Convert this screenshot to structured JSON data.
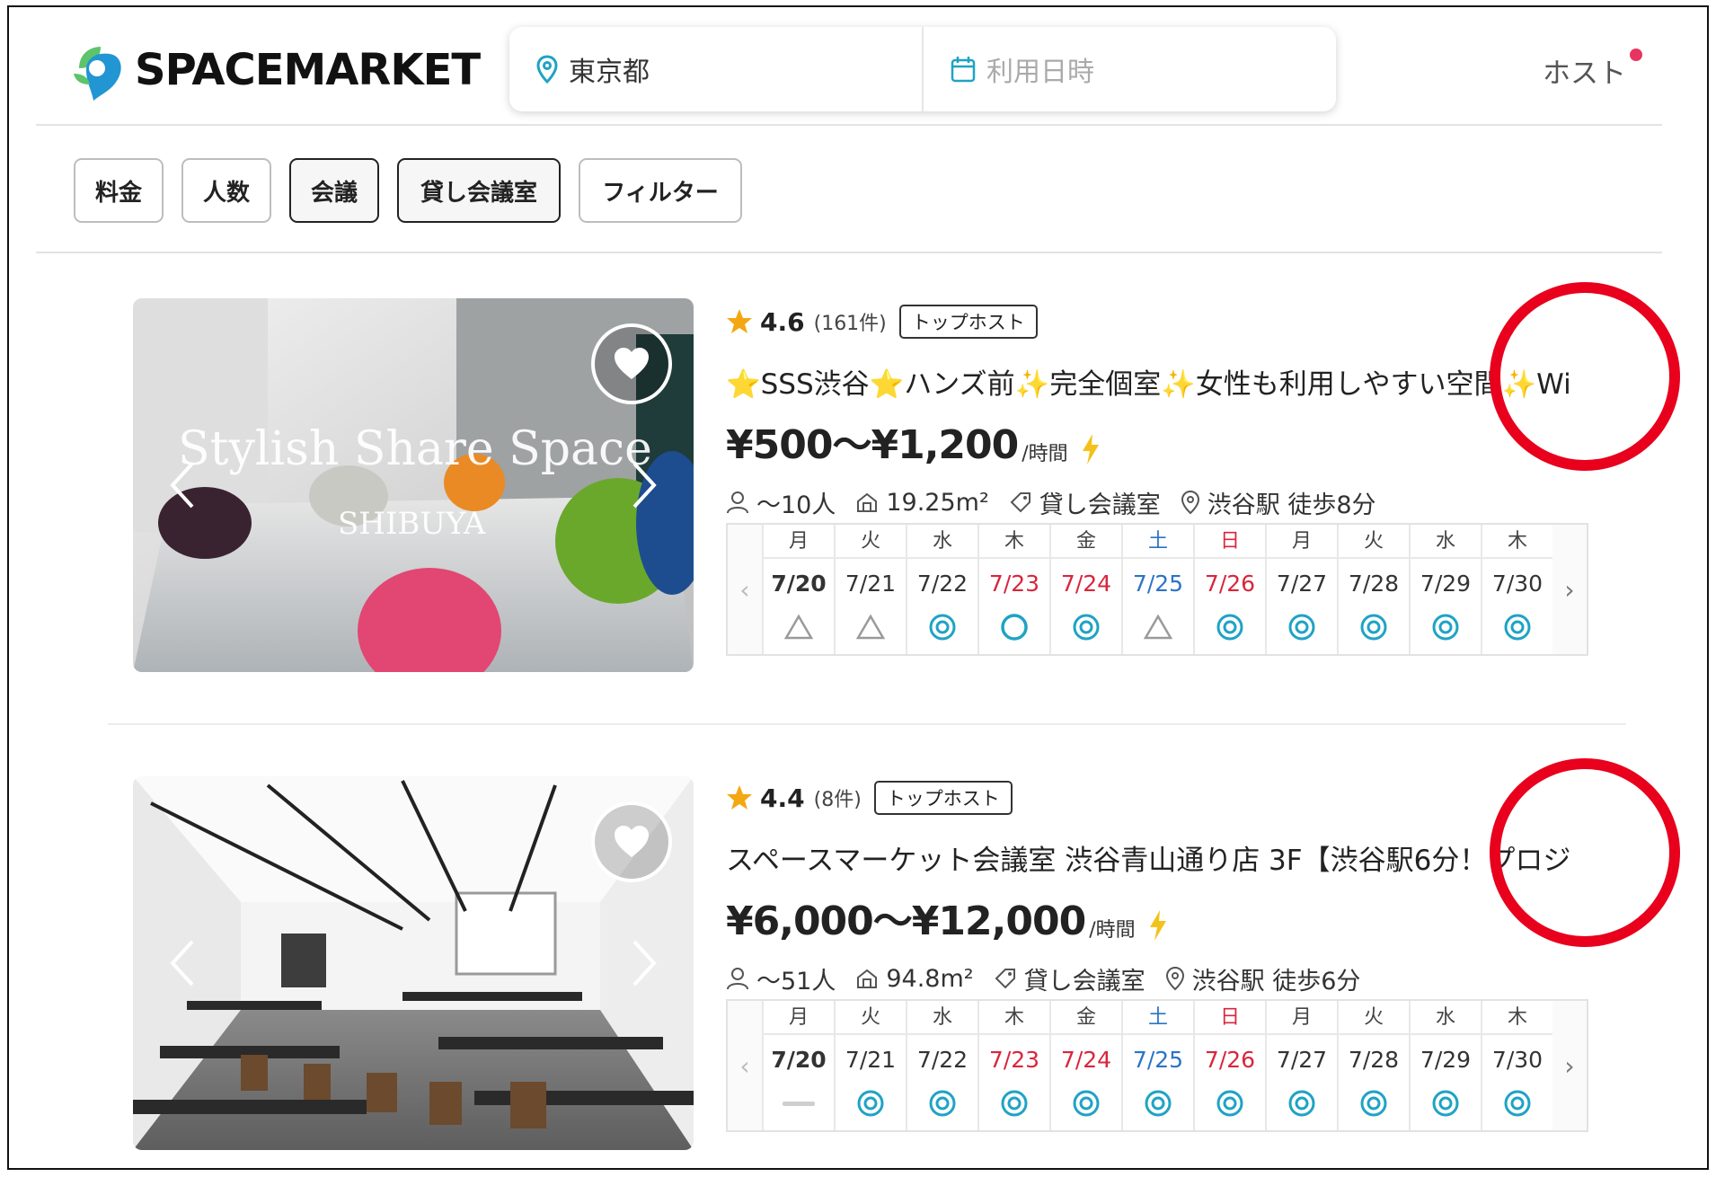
{
  "header": {
    "logo_text": "SPACEMARKET",
    "search_location": "東京都",
    "search_date_placeholder": "利用日時",
    "host_label": "ホスト"
  },
  "filters": [
    "料金",
    "人数",
    "会議",
    "貸し会議室",
    "フィルター"
  ],
  "colors": {
    "accent_teal": "#1fa3c4",
    "brand_green": "#5cc46b",
    "brand_blue": "#2196d3",
    "host_dot": "#e83460",
    "weekend_red": "#d8263c",
    "saturday_blue": "#2a74c7",
    "annotation_red": "#e8001c",
    "star": "#f3a712",
    "bolt": "#f3c21a"
  },
  "listings": [
    {
      "rating": "4.6",
      "review_count": "(161件)",
      "badge": "トップホスト",
      "title": "⭐SSS渋谷⭐ハンズ前✨完全個室✨女性も利用しやすい空間✨WiFi",
      "price": "¥500〜¥1,200",
      "per": "/時間",
      "capacity": "〜10人",
      "area": "19.25m²",
      "category": "貸し会議室",
      "station": "渋谷駅 徒歩8分",
      "photo_text_1": "Stylish Share Space",
      "photo_text_2": "SHIBUYA",
      "calendar": [
        {
          "wd": "月",
          "date": "7/20",
          "mark": "triangle",
          "color": "normal"
        },
        {
          "wd": "火",
          "date": "7/21",
          "mark": "triangle",
          "color": "normal"
        },
        {
          "wd": "水",
          "date": "7/22",
          "mark": "double",
          "color": "normal"
        },
        {
          "wd": "木",
          "date": "7/23",
          "mark": "circle",
          "color": "red"
        },
        {
          "wd": "金",
          "date": "7/24",
          "mark": "double",
          "color": "red"
        },
        {
          "wd": "土",
          "date": "7/25",
          "mark": "triangle",
          "color": "blue"
        },
        {
          "wd": "日",
          "date": "7/26",
          "mark": "double",
          "color": "red"
        },
        {
          "wd": "月",
          "date": "7/27",
          "mark": "double",
          "color": "normal"
        },
        {
          "wd": "火",
          "date": "7/28",
          "mark": "double",
          "color": "normal"
        },
        {
          "wd": "水",
          "date": "7/29",
          "mark": "double",
          "color": "normal"
        },
        {
          "wd": "木",
          "date": "7/30",
          "mark": "double",
          "color": "normal"
        }
      ]
    },
    {
      "rating": "4.4",
      "review_count": "(8件)",
      "badge": "トップホスト",
      "title": "スペースマーケット会議室 渋谷青山通り店 3F【渋谷駅6分！プロジ",
      "price": "¥6,000〜¥12,000",
      "per": "/時間",
      "capacity": "〜51人",
      "area": "94.8m²",
      "category": "貸し会議室",
      "station": "渋谷駅 徒歩6分",
      "calendar": [
        {
          "wd": "月",
          "date": "7/20",
          "mark": "dash",
          "color": "normal"
        },
        {
          "wd": "火",
          "date": "7/21",
          "mark": "double",
          "color": "normal"
        },
        {
          "wd": "水",
          "date": "7/22",
          "mark": "double",
          "color": "normal"
        },
        {
          "wd": "木",
          "date": "7/23",
          "mark": "double",
          "color": "red"
        },
        {
          "wd": "金",
          "date": "7/24",
          "mark": "double",
          "color": "red"
        },
        {
          "wd": "土",
          "date": "7/25",
          "mark": "double",
          "color": "blue"
        },
        {
          "wd": "日",
          "date": "7/26",
          "mark": "double",
          "color": "red"
        },
        {
          "wd": "月",
          "date": "7/27",
          "mark": "double",
          "color": "normal"
        },
        {
          "wd": "火",
          "date": "7/28",
          "mark": "double",
          "color": "normal"
        },
        {
          "wd": "水",
          "date": "7/29",
          "mark": "double",
          "color": "normal"
        },
        {
          "wd": "木",
          "date": "7/30",
          "mark": "double",
          "color": "normal"
        }
      ]
    }
  ]
}
